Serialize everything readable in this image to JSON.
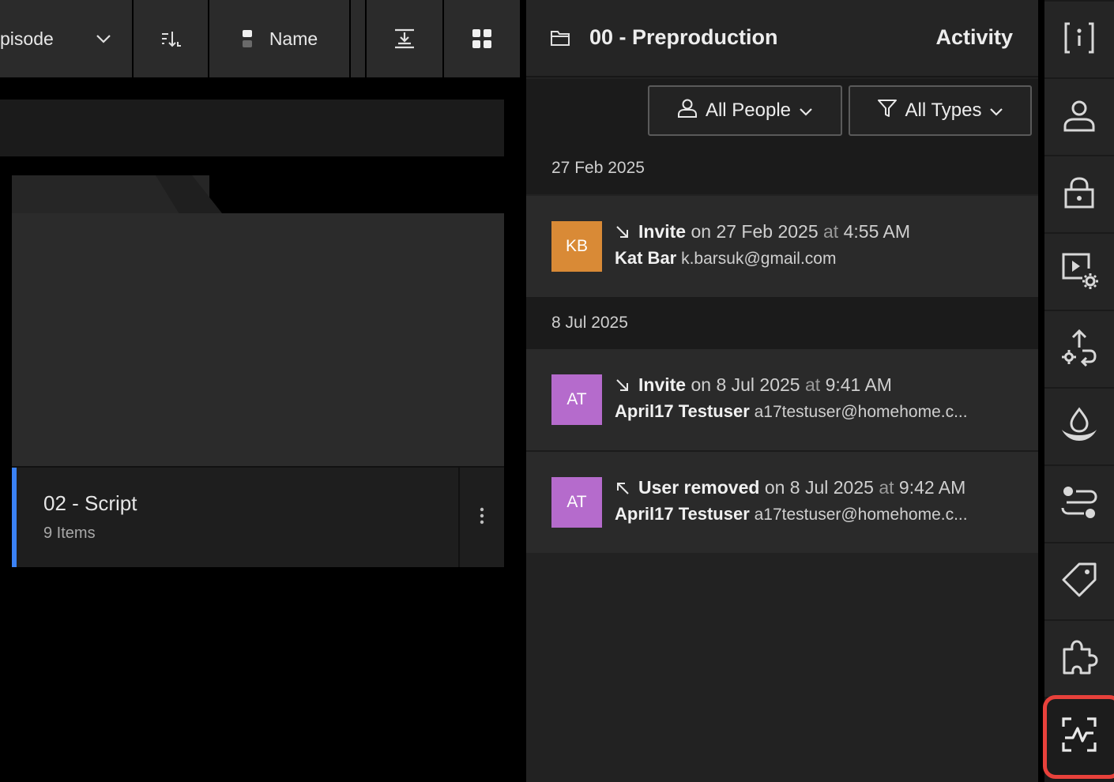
{
  "toolbar": {
    "sort_field_label": "pisode",
    "name_label": "Name"
  },
  "folder": {
    "title": "02 - Script",
    "count": "9 Items"
  },
  "activity": {
    "folder_name": "00 - Preproduction",
    "panel_title": "Activity",
    "filters": {
      "people": "All People",
      "types": "All Types"
    },
    "groups": [
      {
        "date": "27 Feb 2025",
        "entries": [
          {
            "initials": "KB",
            "avatar_color": "#d98a36",
            "action": "Invite",
            "on": "on",
            "date": "27 Feb 2025",
            "at": "at",
            "time": "4:55 AM",
            "user_name": "Kat Bar",
            "user_email": "k.barsuk@gmail.com"
          }
        ]
      },
      {
        "date": "8 Jul 2025",
        "entries": [
          {
            "initials": "AT",
            "avatar_color": "#b56bcc",
            "action": "Invite",
            "on": "on",
            "date": "8 Jul 2025",
            "at": "at",
            "time": "9:41 AM",
            "user_name": "April17 Testuser",
            "user_email": "a17testuser@homehome.c..."
          },
          {
            "initials": "AT",
            "avatar_color": "#b56bcc",
            "action": "User removed",
            "on": "on",
            "date": "8 Jul 2025",
            "at": "at",
            "time": "9:42 AM",
            "user_name": "April17 Testuser",
            "user_email": "a17testuser@homehome.c..."
          }
        ]
      }
    ]
  },
  "rail": {
    "items": [
      "info-icon",
      "person-icon",
      "lock-icon",
      "media-settings-icon",
      "upload-settings-icon",
      "watermark-icon",
      "toggles-icon",
      "tag-icon",
      "puzzle-icon",
      "activity-icon"
    ],
    "active": "activity-icon",
    "highlight_color": "#e8413b"
  }
}
